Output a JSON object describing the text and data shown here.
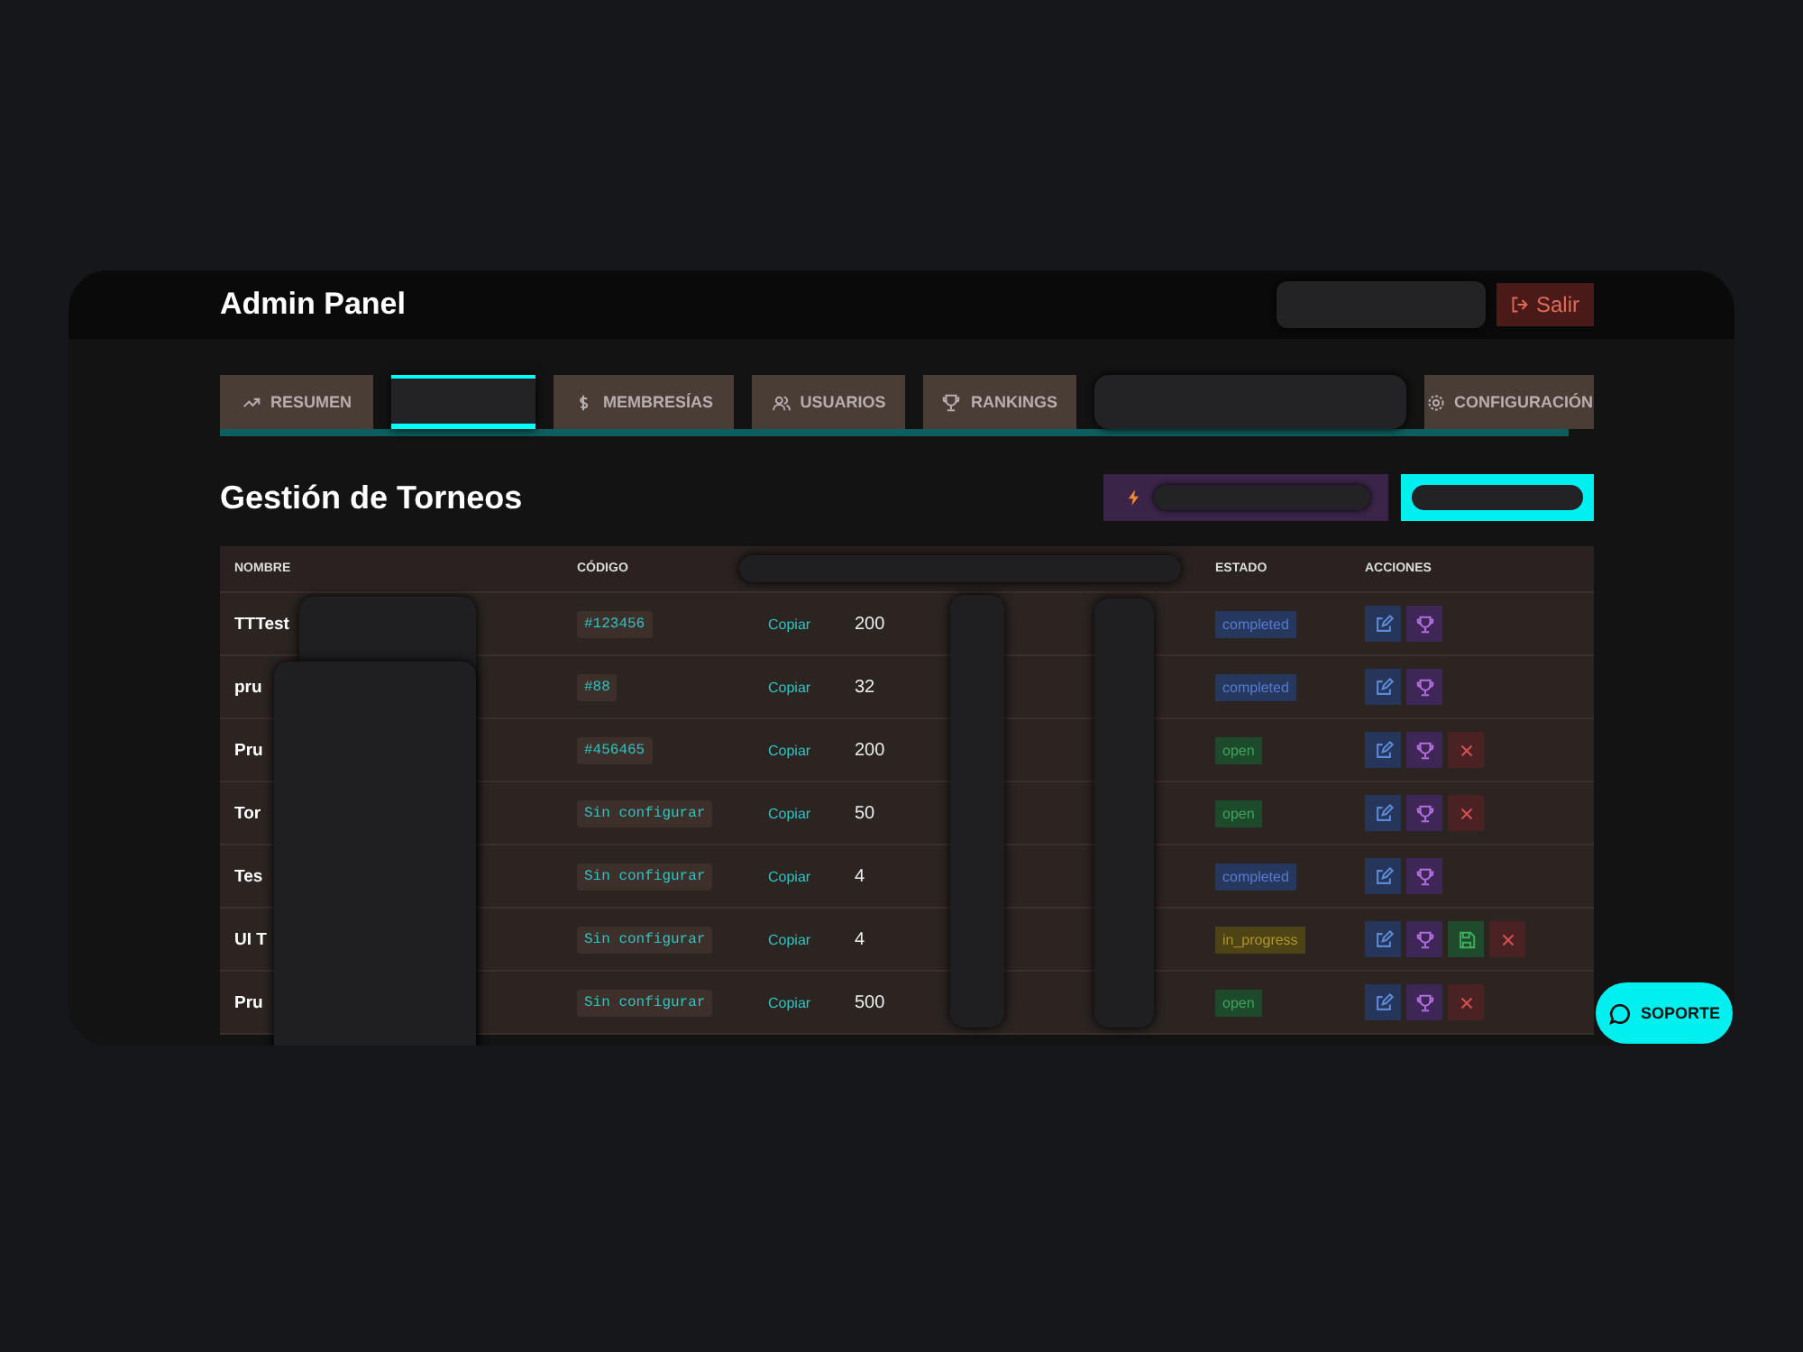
{
  "header": {
    "title": "Admin Panel",
    "logout_button": "Salir"
  },
  "tabs": [
    {
      "kind": "tab",
      "label": "RESUMEN",
      "selected": false
    },
    {
      "kind": "redacted",
      "selected": true
    },
    {
      "kind": "tab",
      "label": "MEMBRESÍAS",
      "selected": false
    },
    {
      "kind": "tab",
      "label": "USUARIOS",
      "selected": false
    },
    {
      "kind": "tab",
      "label": "RANKINGS",
      "selected": false
    },
    {
      "kind": "redacted",
      "selected": false
    },
    {
      "kind": "tab",
      "label": "CONFIGURACIÓN",
      "selected": false
    }
  ],
  "page_title": "Gestión de Torneos",
  "table": {
    "columns": [
      "NOMBRE",
      "CÓDIGO",
      "",
      "",
      "",
      "",
      "ESTADO",
      "ACCIONES"
    ],
    "rows": [
      {
        "name": "TTTest",
        "code": "#123456",
        "copy": "Copiar",
        "column_4": "200",
        "status": {
          "text": "completed",
          "color": "#27385e"
        },
        "actions": [
          {
            "kind": "edit"
          },
          {
            "kind": "trophy"
          }
        ]
      },
      {
        "name": "pru",
        "code": "#88",
        "copy": "Copiar",
        "column_4": "32",
        "status": {
          "text": "completed",
          "color": "#27385e"
        },
        "actions": [
          {
            "kind": "edit"
          },
          {
            "kind": "trophy"
          }
        ]
      },
      {
        "name": "Pru",
        "code": "#456465",
        "copy": "Copiar",
        "column_4": "200",
        "status": {
          "text": "open",
          "color": "#1d4a2b"
        },
        "actions": [
          {
            "kind": "edit"
          },
          {
            "kind": "trophy"
          },
          {
            "kind": "delete"
          }
        ]
      },
      {
        "name": "Tor",
        "code": "Sin configurar",
        "copy": "Copiar",
        "column_4": "50",
        "status": {
          "text": "open",
          "color": "#1d4a2b"
        },
        "actions": [
          {
            "kind": "edit"
          },
          {
            "kind": "trophy"
          },
          {
            "kind": "delete"
          }
        ]
      },
      {
        "name": "Tes",
        "code": "Sin configurar",
        "copy": "Copiar",
        "column_4": "4",
        "status": {
          "text": "completed",
          "color": "#27385e"
        },
        "actions": [
          {
            "kind": "edit"
          },
          {
            "kind": "trophy"
          }
        ]
      },
      {
        "name": "UI T",
        "code": "Sin configurar",
        "copy": "Copiar",
        "column_4": "4",
        "status": {
          "text": "in_progress",
          "color": "#4e4314"
        },
        "actions": [
          {
            "kind": "edit"
          },
          {
            "kind": "trophy"
          },
          {
            "kind": "save"
          },
          {
            "kind": "delete"
          }
        ]
      },
      {
        "name": "Pru",
        "code": "Sin configurar",
        "copy": "Copiar",
        "column_4": "500",
        "status": {
          "text": "open",
          "color": "#1d4a2b"
        },
        "actions": [
          {
            "kind": "edit"
          },
          {
            "kind": "trophy"
          },
          {
            "kind": "delete"
          }
        ]
      }
    ]
  },
  "support_button": "SOPORTE"
}
